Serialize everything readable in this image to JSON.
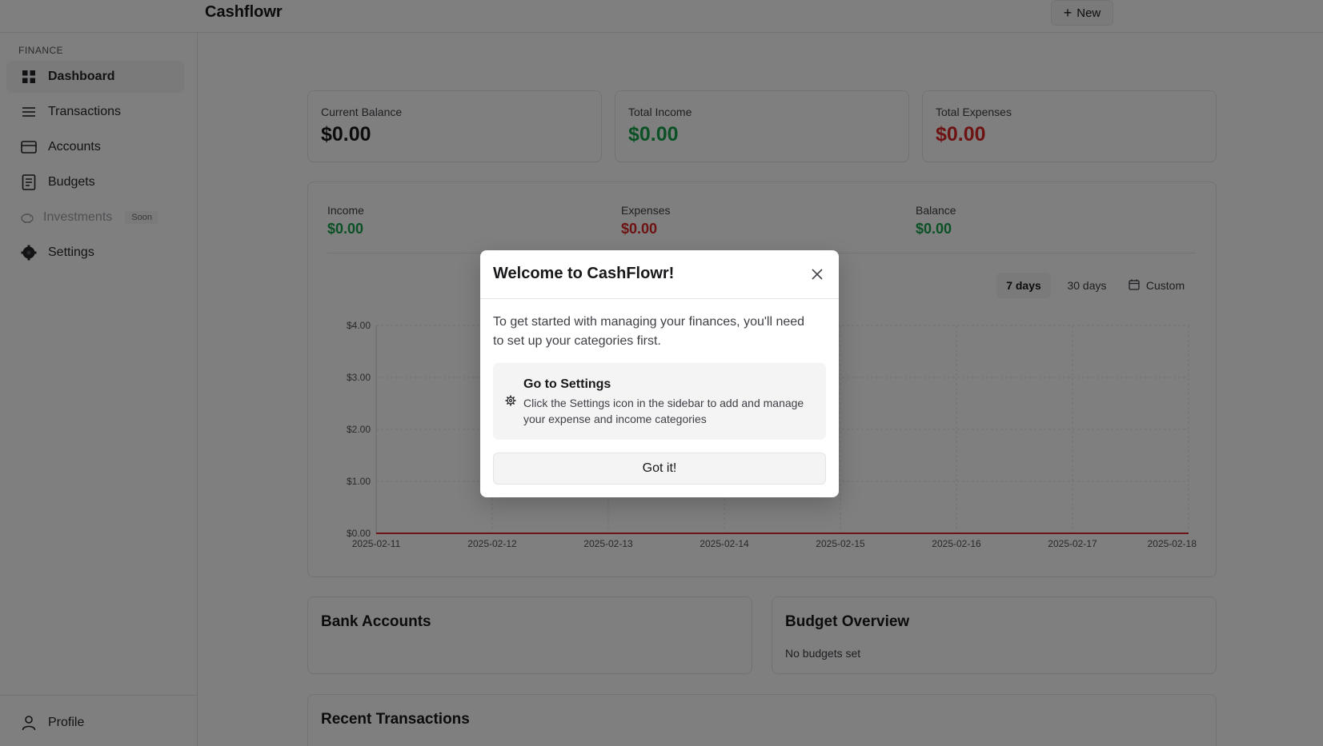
{
  "app": {
    "title": "Cashflowr",
    "new_label": "New"
  },
  "sidebar": {
    "section_label": "FINANCE",
    "items": [
      {
        "label": "Dashboard",
        "icon": "grid-icon",
        "active": true
      },
      {
        "label": "Transactions",
        "icon": "list-icon"
      },
      {
        "label": "Accounts",
        "icon": "card-icon"
      },
      {
        "label": "Budgets",
        "icon": "receipt-icon"
      },
      {
        "label": "Investments",
        "icon": "piggy-bank-icon",
        "disabled": true,
        "badge": "Soon"
      },
      {
        "label": "Settings",
        "icon": "gear-icon"
      }
    ],
    "profile_label": "Profile"
  },
  "stats": {
    "balance": {
      "label": "Current Balance",
      "value": "$0.00"
    },
    "income": {
      "label": "Total Income",
      "value": "$0.00"
    },
    "expenses": {
      "label": "Total Expenses",
      "value": "$0.00"
    }
  },
  "summary": {
    "income": {
      "label": "Income",
      "value": "$0.00"
    },
    "expenses": {
      "label": "Expenses",
      "value": "$0.00"
    },
    "balance": {
      "label": "Balance",
      "value": "$0.00"
    }
  },
  "range": {
    "seven": "7 days",
    "thirty": "30 days",
    "custom": "Custom",
    "selected": "7 days"
  },
  "chart_data": {
    "type": "line",
    "x": [
      "2025-02-11",
      "2025-02-12",
      "2025-02-13",
      "2025-02-14",
      "2025-02-15",
      "2025-02-16",
      "2025-02-17",
      "2025-02-18"
    ],
    "y_ticks": [
      "$0.00",
      "$1.00",
      "$2.00",
      "$3.00",
      "$4.00"
    ],
    "ylim": [
      0,
      4
    ],
    "series": [
      {
        "values": [
          0,
          0,
          0,
          0,
          0,
          0,
          0,
          0
        ],
        "color": "#dc2626"
      }
    ],
    "grid": true
  },
  "bank_accounts": {
    "title": "Bank Accounts"
  },
  "budget_overview": {
    "title": "Budget Overview",
    "empty_text": "No budgets set"
  },
  "recent": {
    "title": "Recent Transactions"
  },
  "modal": {
    "title": "Welcome to CashFlowr!",
    "body": "To get started with managing your finances, you'll need to set up your categories first.",
    "tip_title": "Go to Settings",
    "tip_desc": "Click the Settings icon in the sidebar to add and manage your expense and income categories",
    "button": "Got it!"
  }
}
